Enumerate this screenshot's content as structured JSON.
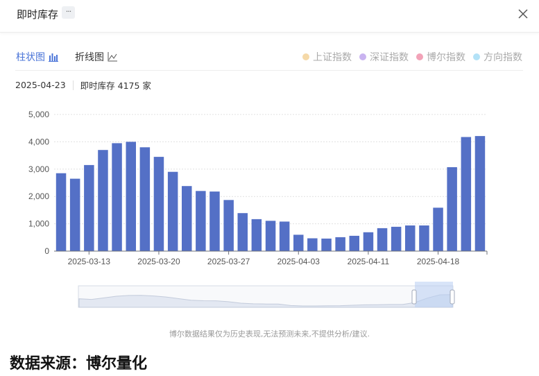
{
  "header": {
    "title": "即时库存",
    "more_label": "···"
  },
  "tabs": [
    {
      "label": "柱状图",
      "active": true
    },
    {
      "label": "折线图",
      "active": false
    }
  ],
  "legend": [
    {
      "label": "上证指数",
      "color": "#f5d9a8"
    },
    {
      "label": "深证指数",
      "color": "#c9b3f0"
    },
    {
      "label": "博尔指数",
      "color": "#f2a3b8"
    },
    {
      "label": "方向指数",
      "color": "#b3e2f7"
    }
  ],
  "info": {
    "date": "2025-04-23",
    "summary": "即时库存 4175 家"
  },
  "chart_data": {
    "type": "bar",
    "title": "",
    "xlabel": "",
    "ylabel": "",
    "ylim": [
      0,
      5000
    ],
    "yticks": [
      "0",
      "1,000",
      "2,000",
      "3,000",
      "4,000",
      "5,000"
    ],
    "x_tick_labels": [
      "2025-03-13",
      "2025-03-20",
      "2025-03-27",
      "2025-04-03",
      "2025-04-11",
      "2025-04-18"
    ],
    "x_tick_indices": [
      2,
      7,
      12,
      17,
      22,
      27
    ],
    "bar_color": "#5470c6",
    "grid": true,
    "values": [
      2850,
      2650,
      3150,
      3700,
      3950,
      4000,
      3800,
      3450,
      2900,
      2380,
      2200,
      2180,
      1870,
      1390,
      1170,
      1110,
      1080,
      600,
      470,
      460,
      510,
      560,
      690,
      840,
      890,
      940,
      940,
      1590,
      3070,
      4175,
      4210
    ]
  },
  "disclaimer": "博尔数据结果仅为历史表现,无法预测未来,不提供分析/建议.",
  "source": "数据来源：博尔量化"
}
